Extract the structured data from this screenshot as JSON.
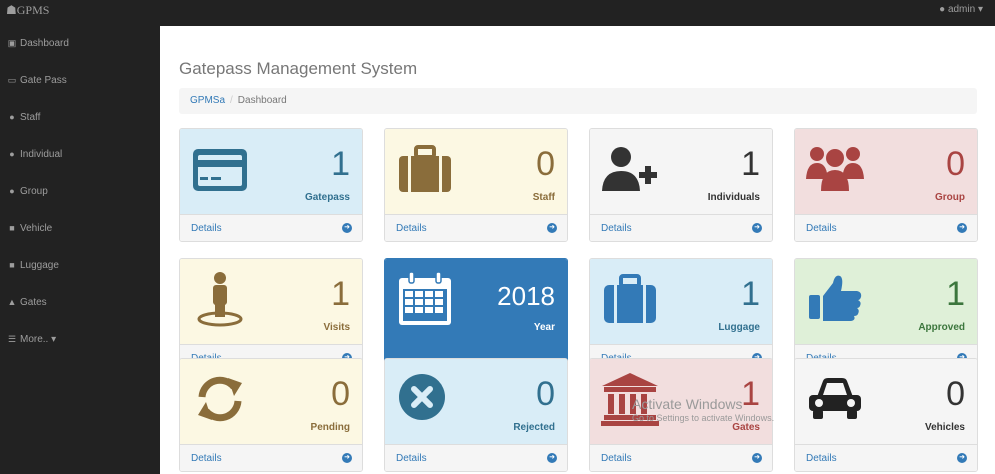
{
  "app": {
    "brand": "GPMS",
    "user": "admin"
  },
  "sidebar": {
    "items": [
      {
        "label": "Dashboard",
        "icon": "dashboard-icon"
      },
      {
        "label": "Gate Pass",
        "icon": "card-icon"
      },
      {
        "label": "Staff",
        "icon": "users-icon"
      },
      {
        "label": "Individual",
        "icon": "user-plus-icon"
      },
      {
        "label": "Group",
        "icon": "users-icon"
      },
      {
        "label": "Vehicle",
        "icon": "car-icon"
      },
      {
        "label": "Luggage",
        "icon": "suitcase-icon"
      },
      {
        "label": "Gates",
        "icon": "bank-icon"
      },
      {
        "label": "More..",
        "icon": "bars-icon"
      }
    ]
  },
  "page": {
    "title": "Gatepass Management System"
  },
  "breadcrumb": {
    "home": "GPMSa",
    "current": "Dashboard"
  },
  "panels": [
    {
      "value": "1",
      "label": "Gatepass",
      "icon": "credit-card-icon",
      "style": "info",
      "footer": "Details"
    },
    {
      "value": "0",
      "label": "Staff",
      "icon": "briefcase-icon",
      "style": "warning",
      "footer": "Details"
    },
    {
      "value": "1",
      "label": "Individuals",
      "icon": "user-plus-icon",
      "style": "default",
      "footer": "Details"
    },
    {
      "value": "0",
      "label": "Group",
      "icon": "users-icon",
      "style": "danger",
      "footer": "Details"
    },
    {
      "value": "1",
      "label": "Visits",
      "icon": "street-view-icon",
      "style": "warning",
      "footer": "Details"
    },
    {
      "value": "2018",
      "label": "Year",
      "icon": "calendar-icon",
      "style": "primary"
    },
    {
      "value": "1",
      "label": "Luggage",
      "icon": "suitcase-icon",
      "style": "info",
      "footer": "Details"
    },
    {
      "value": "1",
      "label": "Approved",
      "icon": "thumbs-up-icon",
      "style": "success",
      "footer": "Details"
    },
    {
      "value": "0",
      "label": "Pending",
      "icon": "refresh-icon",
      "style": "warning",
      "footer": "Details"
    },
    {
      "value": "0",
      "label": "Rejected",
      "icon": "times-circle-icon",
      "style": "info",
      "footer": "Details"
    },
    {
      "value": "1",
      "label": "Gates",
      "icon": "bank-icon",
      "style": "danger",
      "footer": "Details"
    },
    {
      "value": "0",
      "label": "Vehicles",
      "icon": "car-icon",
      "style": "default",
      "footer": "Details"
    }
  ],
  "watermark": {
    "line1": "Activate Windows",
    "line2": "Go to Settings to activate Windows."
  },
  "colors": {
    "primary": "#337ab7",
    "navbar": "#222222",
    "info": "#d9edf7",
    "warning": "#fcf8e3",
    "danger": "#f2dede",
    "success": "#dff0d8"
  }
}
